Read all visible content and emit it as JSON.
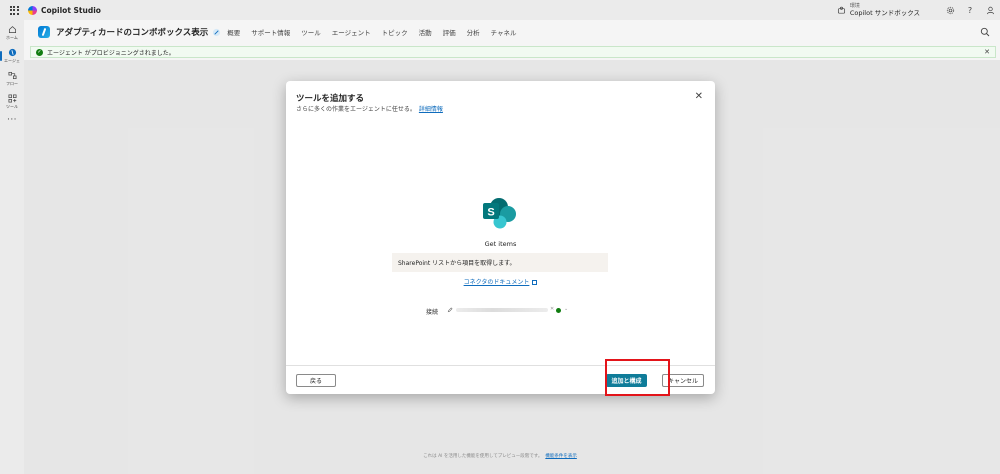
{
  "app": {
    "title": "Copilot Studio"
  },
  "environment": {
    "label": "環境",
    "name": "Copilot サンドボックス"
  },
  "rail": {
    "items": [
      {
        "label": "ホーム",
        "icon": "home-icon"
      },
      {
        "label": "エージェ",
        "icon": "agent-icon"
      },
      {
        "label": "フロー",
        "icon": "flow-icon"
      },
      {
        "label": "ツール",
        "icon": "tools-icon"
      }
    ],
    "more": "···"
  },
  "agent": {
    "name": "アダプティカードのコンボボックス表示",
    "tabs": [
      "概要",
      "サポート情報",
      "ツール",
      "エージェント",
      "トピック",
      "活動",
      "評価",
      "分析",
      "チャネル"
    ]
  },
  "notification": {
    "text": "エージェント がプロビジョニングされました。"
  },
  "dialog": {
    "title": "ツールを追加する",
    "subtitle": "さらに多くの作業をエージェントに任せる。",
    "subtitle_link": "詳細情報",
    "tool_name": "Get items",
    "tool_description": "SharePoint リストから項目を取得します。",
    "doc_link": "コネクタのドキュメント",
    "connection_label": "接続",
    "back_label": "戻る",
    "primary_label": "追加と構成",
    "cancel_label": "キャンセル"
  },
  "footer": {
    "text": "これは AI を活用した機能を使用してプレビュー段階です。",
    "link": "機能条件を表示"
  },
  "colors": {
    "accent": "#0f7c99",
    "success": "#107c10",
    "highlight": "#e3141a",
    "link": "#0f6cbd"
  }
}
